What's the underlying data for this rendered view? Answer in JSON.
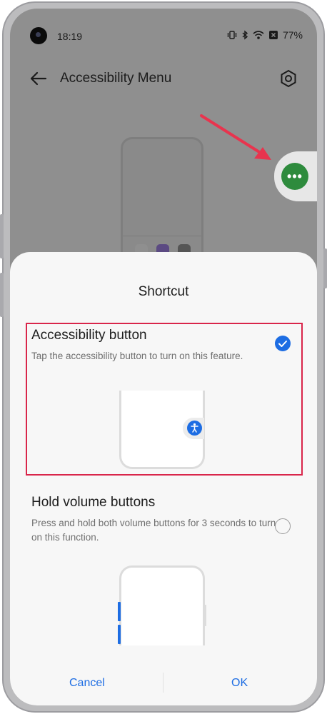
{
  "status_bar": {
    "time": "18:19",
    "battery": "77%"
  },
  "app_bar": {
    "title": "Accessibility Menu"
  },
  "sheet": {
    "title": "Shortcut",
    "options": [
      {
        "title": "Accessibility button",
        "description": "Tap the accessibility button to turn on this feature.",
        "selected": true
      },
      {
        "title": "Hold volume buttons",
        "description": "Press and hold both volume buttons for 3 seconds to turn on this function.",
        "selected": false
      }
    ],
    "cancel_label": "Cancel",
    "ok_label": "OK"
  },
  "floating_button": {
    "glyph": "•••"
  },
  "colors": {
    "accent": "#1d6de3",
    "highlight": "#d9254a",
    "float_green": "#2e8b3d",
    "arrow": "#e8344e"
  }
}
